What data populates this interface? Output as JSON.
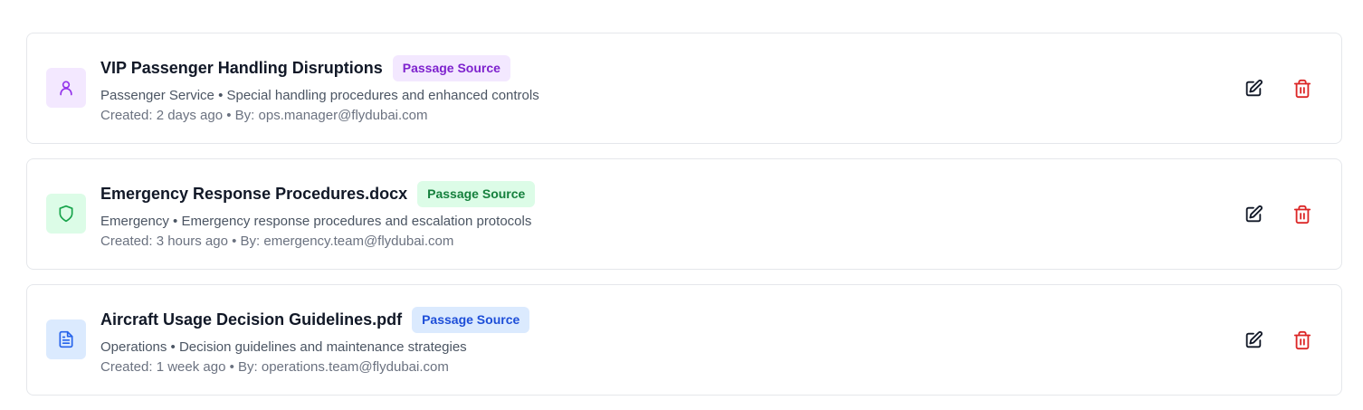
{
  "documents": [
    {
      "title": "VIP Passenger Handling Disruptions",
      "badge": "Passage Source",
      "description": "Passenger Service • Special handling procedures and enhanced controls",
      "meta": "Created: 2 days ago • By: ops.manager@flydubai.com",
      "icon": "user-icon",
      "colors": {
        "icon_bg": "#f3e8ff",
        "icon_fg": "#9333ea",
        "badge_bg": "#f3e8ff",
        "badge_fg": "#7e22ce"
      }
    },
    {
      "title": "Emergency Response Procedures.docx",
      "badge": "Passage Source",
      "description": "Emergency • Emergency response procedures and escalation protocols",
      "meta": "Created: 3 hours ago • By: emergency.team@flydubai.com",
      "icon": "shield-icon",
      "colors": {
        "icon_bg": "#dcfce7",
        "icon_fg": "#16a34a",
        "badge_bg": "#dcfce7",
        "badge_fg": "#15803d"
      }
    },
    {
      "title": "Aircraft Usage Decision Guidelines.pdf",
      "badge": "Passage Source",
      "description": "Operations • Decision guidelines and maintenance strategies",
      "meta": "Created: 1 week ago • By: operations.team@flydubai.com",
      "icon": "file-text-icon",
      "colors": {
        "icon_bg": "#dbeafe",
        "icon_fg": "#2563eb",
        "badge_bg": "#dbeafe",
        "badge_fg": "#1d4ed8"
      }
    }
  ],
  "action_icons": {
    "edit": "edit-icon",
    "delete": "trash-icon"
  },
  "action_colors": {
    "edit": "#111827",
    "delete": "#dc2626"
  }
}
